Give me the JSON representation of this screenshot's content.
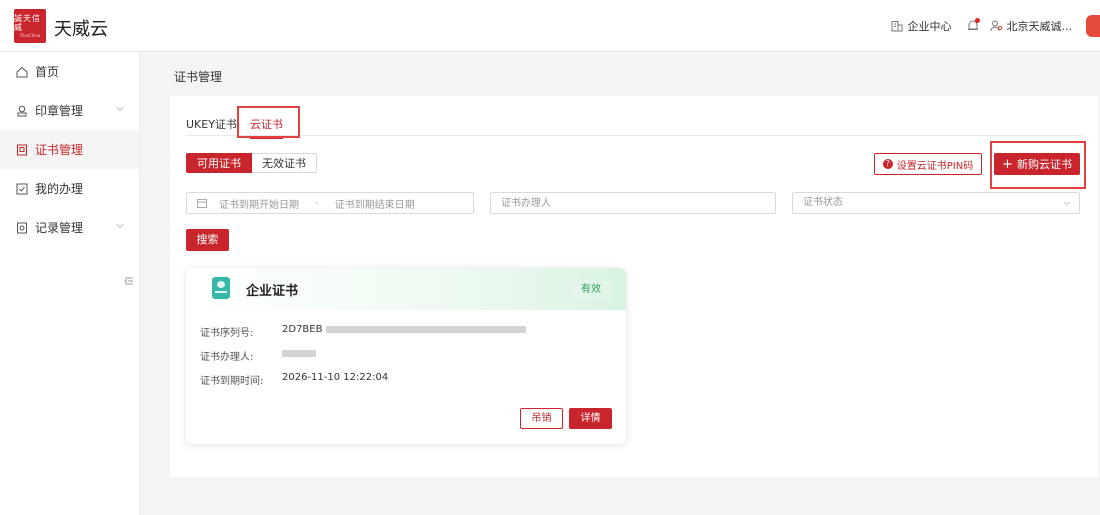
{
  "header": {
    "logo_text": "誠天信威",
    "logo_subtext": "iTrusChina",
    "app_name": "天威云",
    "enterprise_center": "企业中心",
    "user_name": "北京天威诚..."
  },
  "sidebar": {
    "items": [
      {
        "label": "首页",
        "icon": "home-icon"
      },
      {
        "label": "印章管理",
        "icon": "seal-icon"
      },
      {
        "label": "证书管理",
        "icon": "certificate-icon"
      },
      {
        "label": "我的办理",
        "icon": "task-icon"
      },
      {
        "label": "记录管理",
        "icon": "record-icon"
      }
    ]
  },
  "breadcrumb": "证书管理",
  "tabs": [
    "UKEY证书",
    "云证书"
  ],
  "filter_tabs": [
    "可用证书",
    "无效证书"
  ],
  "actions": {
    "set_pin": "设置云证书PIN码",
    "buy": "新购云证书",
    "search": "搜索"
  },
  "filters": {
    "start_date_placeholder": "证书到期开始日期",
    "end_date_placeholder": "证书到期结束日期",
    "separator": "-",
    "person_placeholder": "证书办理人",
    "status_placeholder": "证书状态"
  },
  "card": {
    "title": "企业证书",
    "status": "有效",
    "serial_label": "证书序列号:",
    "serial_value": "2D7BEB",
    "person_label": "证书办理人:",
    "expiry_label": "证书到期时间:",
    "expiry_value": "2026-11-10 12:22:04",
    "revoke": "吊销",
    "detail": "详情"
  },
  "colors": {
    "accent": "#c8252c",
    "valid": "#2fa35a",
    "highlight": "#e34040"
  }
}
